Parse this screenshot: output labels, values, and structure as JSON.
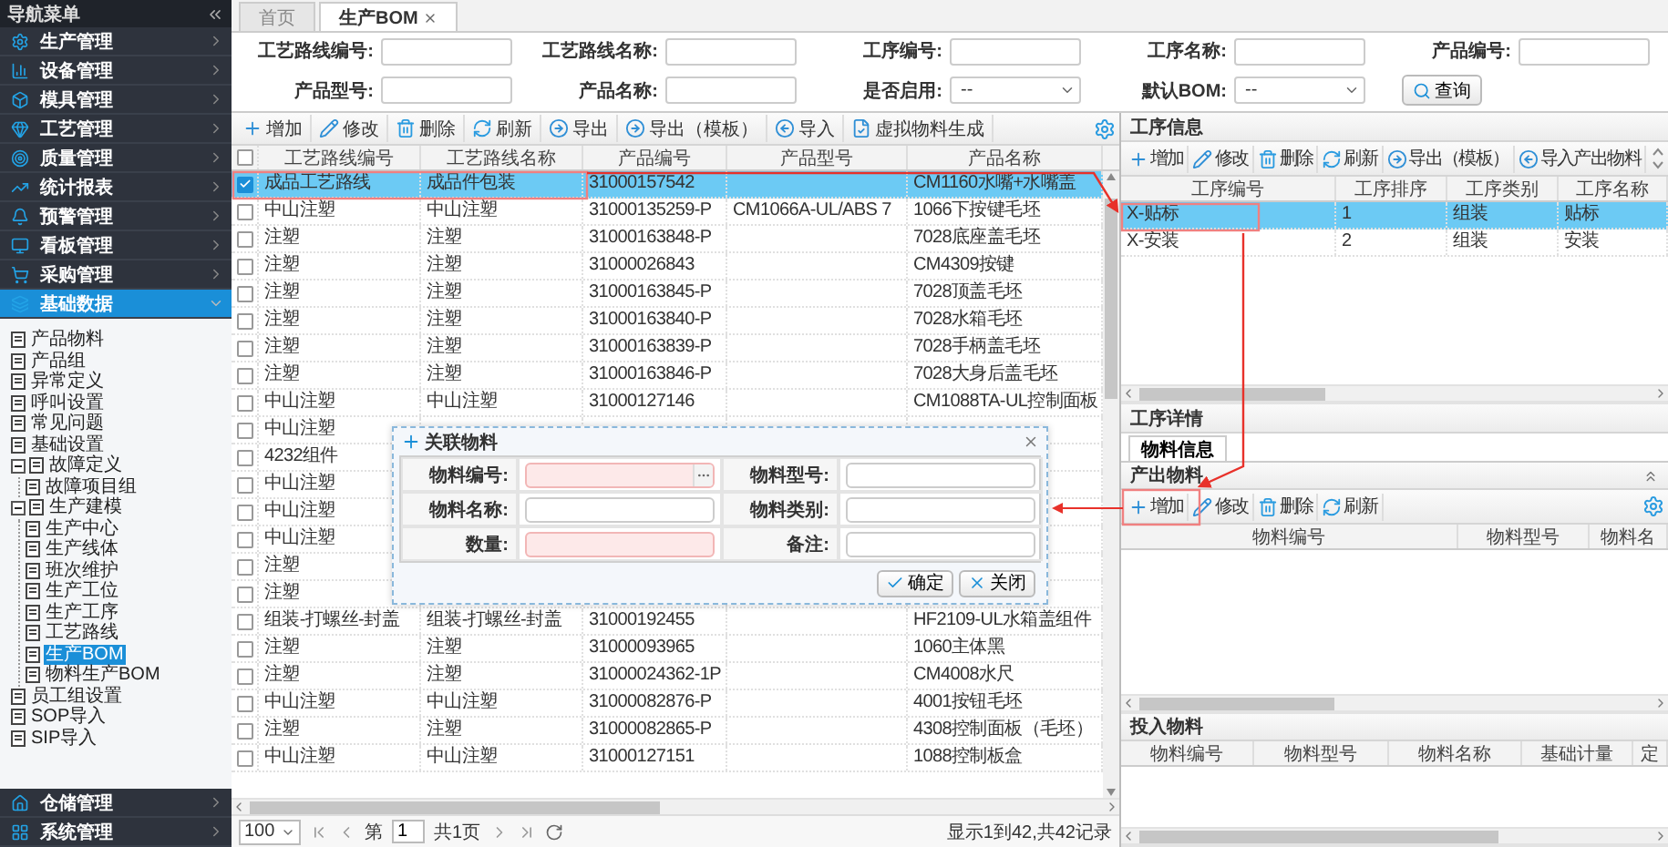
{
  "sidebar": {
    "title": "导航菜单",
    "menu": [
      {
        "label": "生产管理",
        "selected": false,
        "expanded": false
      },
      {
        "label": "设备管理",
        "selected": false,
        "expanded": false
      },
      {
        "label": "模具管理",
        "selected": false,
        "expanded": false
      },
      {
        "label": "工艺管理",
        "selected": false,
        "expanded": false
      },
      {
        "label": "质量管理",
        "selected": false,
        "expanded": false
      },
      {
        "label": "统计报表",
        "selected": false,
        "expanded": false
      },
      {
        "label": "预警管理",
        "selected": false,
        "expanded": false
      },
      {
        "label": "看板管理",
        "selected": false,
        "expanded": false
      },
      {
        "label": "采购管理",
        "selected": false,
        "expanded": false
      },
      {
        "label": "基础数据",
        "selected": true,
        "expanded": true,
        "children": [
          {
            "label": "产品物料",
            "selected": false
          },
          {
            "label": "产品组",
            "selected": false
          },
          {
            "label": "异常定义",
            "selected": false
          },
          {
            "label": "呼叫设置",
            "selected": false
          },
          {
            "label": "常见问题",
            "selected": false
          },
          {
            "label": "基础设置",
            "selected": false
          },
          {
            "label": "故障定义",
            "selected": false,
            "expanded": true,
            "children": [
              {
                "label": "故障项目组",
                "selected": false
              }
            ]
          },
          {
            "label": "生产建模",
            "selected": false,
            "expanded": true,
            "children": [
              {
                "label": "生产中心",
                "selected": false
              },
              {
                "label": "生产线体",
                "selected": false
              },
              {
                "label": "班次维护",
                "selected": false
              },
              {
                "label": "生产工位",
                "selected": false
              },
              {
                "label": "生产工序",
                "selected": false
              },
              {
                "label": "工艺路线",
                "selected": false
              },
              {
                "label": "生产BOM",
                "selected": true
              },
              {
                "label": "物料生产BOM",
                "selected": false
              }
            ]
          },
          {
            "label": "员工组设置",
            "selected": false
          },
          {
            "label": "SOP导入",
            "selected": false
          },
          {
            "label": "SIP导入",
            "selected": false
          }
        ]
      },
      {
        "label": "仓储管理",
        "selected": false,
        "expanded": false
      },
      {
        "label": "系统管理",
        "selected": false,
        "expanded": false
      }
    ]
  },
  "tabs": [
    {
      "label": "首页",
      "selected": false,
      "closable": false
    },
    {
      "label": "生产BOM",
      "selected": true,
      "closable": true
    }
  ],
  "filters": [
    {
      "label": "工艺路线编号:",
      "kind": "text"
    },
    {
      "label": "工艺路线名称:",
      "kind": "text"
    },
    {
      "label": "工序编号:",
      "kind": "text"
    },
    {
      "label": "工序名称:",
      "kind": "text"
    },
    {
      "label": "产品编号:",
      "kind": "text"
    },
    {
      "label": "产品型号:",
      "kind": "text"
    },
    {
      "label": "产品名称:",
      "kind": "text"
    },
    {
      "label": "是否启用:",
      "kind": "select",
      "value": "--"
    },
    {
      "label": "默认BOM:",
      "kind": "select",
      "value": "--"
    }
  ],
  "search_button": "查询",
  "bom_grid": {
    "toolbar": [
      {
        "label": "增加",
        "kind": "add"
      },
      {
        "label": "修改",
        "kind": "edit"
      },
      {
        "label": "删除",
        "kind": "delete"
      },
      {
        "label": "刷新",
        "kind": "refresh"
      },
      {
        "label": "导出",
        "kind": "export"
      },
      {
        "label": "导出（模板）",
        "kind": "export"
      },
      {
        "label": "导入",
        "kind": "import"
      },
      {
        "label": "虚拟物料生成",
        "kind": "generate"
      }
    ],
    "all_checked": false,
    "columns": [
      "工艺路线编号",
      "工艺路线名称",
      "产品编号",
      "产品型号",
      "产品名称"
    ],
    "rows": [
      {
        "selected": true,
        "checked": true,
        "cells": {
          "route_code": "成品工艺路线",
          "route_name": "成品件包装",
          "product_code": "31000157542",
          "product_name": "CM1160水嘴+水嘴盖"
        }
      },
      {
        "selected": false,
        "checked": false,
        "cells": {
          "route_code": "中山注塑",
          "route_name": "中山注塑",
          "product_code": "31000135259-P",
          "product_model": "CM1066A-UL/ABS 7",
          "product_name": "1066下按键毛坯"
        }
      },
      {
        "selected": false,
        "checked": false,
        "cells": {
          "route_code": "注塑",
          "route_name": "注塑",
          "product_code": "31000163848-P",
          "product_name": "7028底座盖毛坯"
        }
      },
      {
        "selected": false,
        "checked": false,
        "cells": {
          "route_code": "注塑",
          "route_name": "注塑",
          "product_code": "31000026843",
          "product_name": "CM4309按键"
        }
      },
      {
        "selected": false,
        "checked": false,
        "cells": {
          "route_code": "注塑",
          "route_name": "注塑",
          "product_code": "31000163845-P",
          "product_name": "7028顶盖毛坯"
        }
      },
      {
        "selected": false,
        "checked": false,
        "cells": {
          "route_code": "注塑",
          "route_name": "注塑",
          "product_code": "31000163840-P",
          "product_name": "7028水箱毛坯"
        }
      },
      {
        "selected": false,
        "checked": false,
        "cells": {
          "route_code": "注塑",
          "route_name": "注塑",
          "product_code": "31000163839-P",
          "product_name": "7028手柄盖毛坯"
        }
      },
      {
        "selected": false,
        "checked": false,
        "cells": {
          "route_code": "注塑",
          "route_name": "注塑",
          "product_code": "31000163846-P",
          "product_name": "7028大身后盖毛坯"
        }
      },
      {
        "selected": false,
        "checked": false,
        "cells": {
          "route_code": "中山注塑",
          "route_name": "中山注塑",
          "product_code": "31000127146",
          "product_name": "CM1088TA-UL控制面板"
        }
      },
      {
        "selected": false,
        "checked": false,
        "cells": {
          "route_code": "中山注塑"
        }
      },
      {
        "selected": false,
        "checked": false,
        "cells": {
          "route_code": "4232组件"
        }
      },
      {
        "selected": false,
        "checked": false,
        "cells": {
          "route_code": "中山注塑"
        }
      },
      {
        "selected": false,
        "checked": false,
        "cells": {
          "route_code": "中山注塑"
        }
      },
      {
        "selected": false,
        "checked": false,
        "cells": {
          "route_code": "中山注塑"
        }
      },
      {
        "selected": false,
        "checked": false,
        "cells": {
          "route_code": "注塑"
        }
      },
      {
        "selected": false,
        "checked": false,
        "cells": {
          "route_code": "注塑"
        }
      },
      {
        "selected": false,
        "checked": false,
        "cells": {
          "route_code": "组装-打螺丝-封盖",
          "route_name": "组装-打螺丝-封盖",
          "product_code": "31000192455",
          "product_name": "HF2109-UL水箱盖组件"
        }
      },
      {
        "selected": false,
        "checked": false,
        "cells": {
          "route_code": "注塑",
          "route_name": "注塑",
          "product_code": "31000093965",
          "product_name": "1060主体黑"
        }
      },
      {
        "selected": false,
        "checked": false,
        "cells": {
          "route_code": "注塑",
          "route_name": "注塑",
          "product_code": "31000024362-1P",
          "product_name": "CM4008水尺"
        }
      },
      {
        "selected": false,
        "checked": false,
        "cells": {
          "route_code": "中山注塑",
          "route_name": "中山注塑",
          "product_code": "31000082876-P",
          "product_name": "4001按钮毛坯"
        }
      },
      {
        "selected": false,
        "checked": false,
        "cells": {
          "route_code": "注塑",
          "route_name": "注塑",
          "product_code": "31000082865-P",
          "product_name": "4308控制面板（毛坯）"
        }
      },
      {
        "selected": false,
        "checked": false,
        "cells": {
          "route_code": "中山注塑",
          "route_name": "中山注塑",
          "product_code": "31000127151",
          "product_name": "1088控制板盒"
        }
      }
    ],
    "pager": {
      "page_size": "100",
      "page_label": "第",
      "page": "1",
      "page_total": "共1页",
      "summary": "显示1到42,共42记录"
    }
  },
  "dialog": {
    "title": "关联物料",
    "fields": [
      {
        "label": "物料编号:",
        "kind": "lookup",
        "required": true
      },
      {
        "label": "物料型号:",
        "kind": "text",
        "required": false
      },
      {
        "label": "物料名称:",
        "kind": "text",
        "required": false
      },
      {
        "label": "物料类别:",
        "kind": "text",
        "required": false
      },
      {
        "label": "数量:",
        "kind": "text",
        "required": true
      },
      {
        "label": "备注:",
        "kind": "text",
        "required": false
      }
    ],
    "buttons": [
      {
        "label": "确定",
        "kind": "ok"
      },
      {
        "label": "关闭",
        "kind": "close"
      }
    ]
  },
  "process_info": {
    "title": "工序信息",
    "toolbar": [
      {
        "label": "增加",
        "kind": "add"
      },
      {
        "label": "修改",
        "kind": "edit"
      },
      {
        "label": "删除",
        "kind": "delete"
      },
      {
        "label": "刷新",
        "kind": "refresh"
      },
      {
        "label": "导出（模板）",
        "kind": "export"
      },
      {
        "label": "导入产出物料",
        "kind": "import"
      }
    ],
    "columns": [
      "工序编号",
      "工序排序",
      "工序类别",
      "工序名称"
    ],
    "rows": [
      {
        "selected": true,
        "cells": [
          "X-贴标",
          "1",
          "组装",
          "贴标"
        ]
      },
      {
        "selected": false,
        "cells": [
          "X-安装",
          "2",
          "组装",
          "安装"
        ]
      }
    ]
  },
  "process_detail": {
    "title": "工序详情",
    "tabs": [
      {
        "label": "物料信息",
        "selected": true
      }
    ],
    "output_materials": {
      "title": "产出物料",
      "toolbar": [
        {
          "label": "增加",
          "kind": "add"
        },
        {
          "label": "修改",
          "kind": "edit"
        },
        {
          "label": "删除",
          "kind": "delete"
        },
        {
          "label": "刷新",
          "kind": "refresh"
        }
      ],
      "columns": [
        "物料编号",
        "物料型号",
        "物料名"
      ]
    },
    "input_materials": {
      "title": "投入物料",
      "columns": [
        "物料编号",
        "物料型号",
        "物料名称",
        "基础计量",
        "定"
      ]
    }
  }
}
